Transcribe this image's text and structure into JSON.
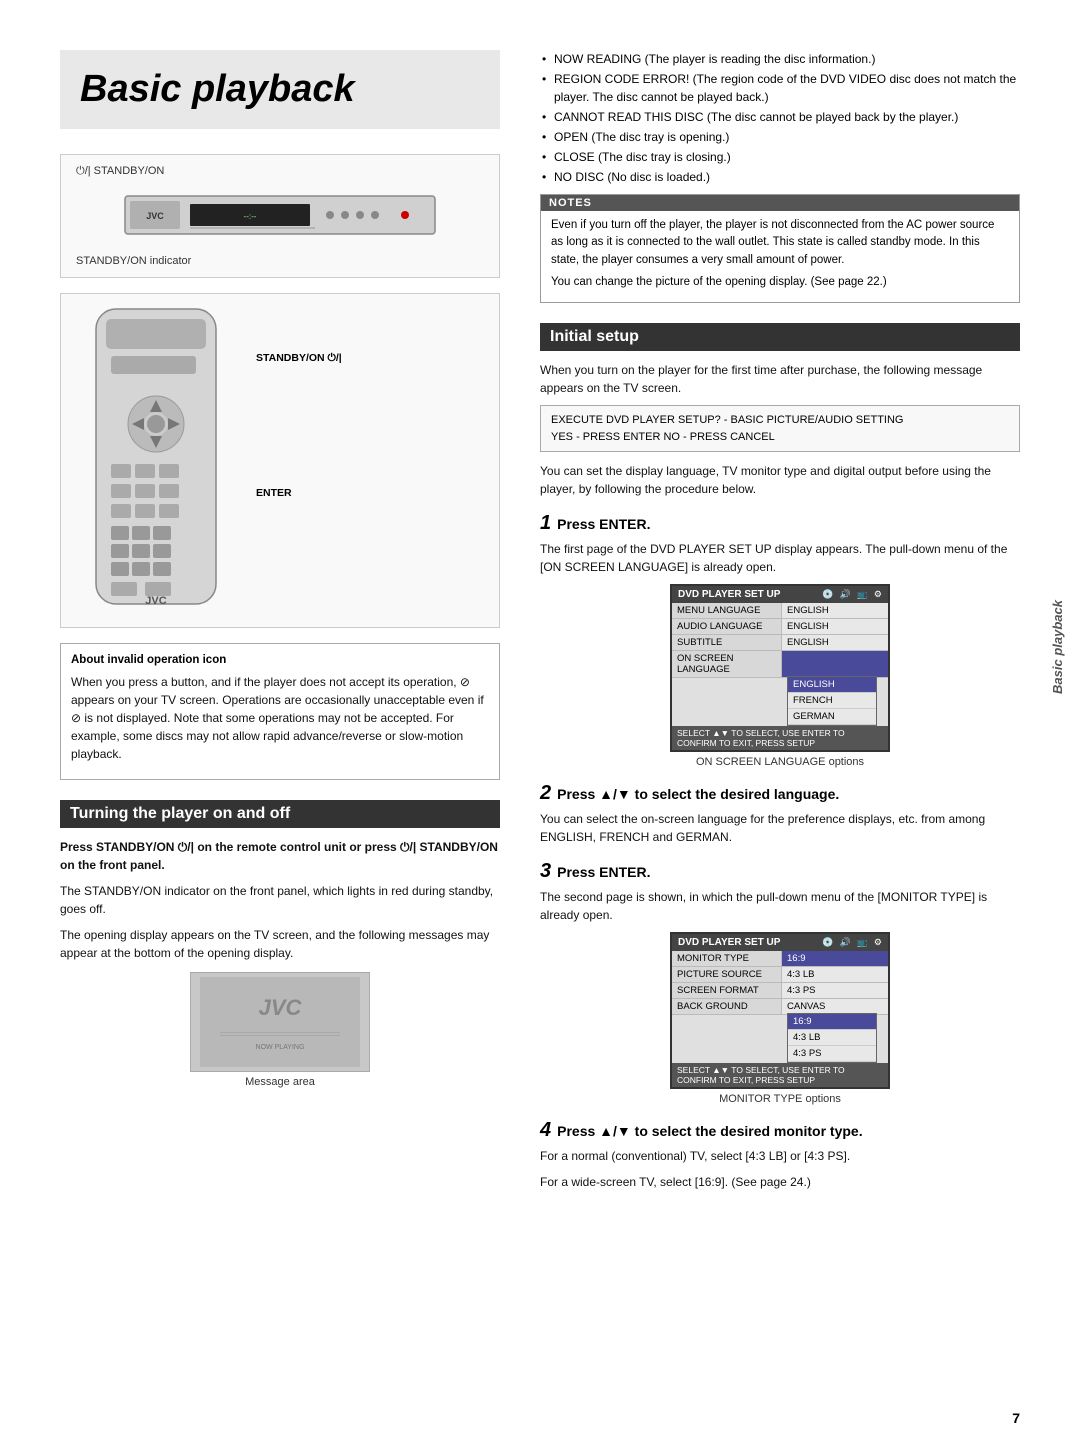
{
  "page": {
    "title": "Basic playback",
    "page_number": "7",
    "side_label": "Basic playback"
  },
  "left_column": {
    "device_section": {
      "standby_label_top": "⏻/| STANDBY/ON",
      "standby_indicator_label": "STANDBY/ON indicator"
    },
    "remote_section": {
      "standby_label": "STANDBY/ON ⏻/|",
      "enter_label": "ENTER"
    },
    "invalid_op_section": {
      "title": "About invalid operation icon",
      "body": "When you press a button, and if the player does not accept its operation, ⊘ appears on your TV screen. Operations are occasionally unacceptable even if ⊘ is not displayed. Note that some operations may not be accepted. For example, some discs may not allow rapid advance/reverse or slow-motion playback."
    },
    "turning_section": {
      "header": "Turning the player on and off",
      "body_bold": "Press STANDBY/ON ⏻/| on the remote control unit or press ⏻/| STANDBY/ON on the front panel.",
      "body1": "The STANDBY/ON indicator on the front panel, which lights in red during standby, goes off.",
      "body2": "The opening display appears on the TV screen, and the following messages may appear at the bottom of the opening display.",
      "message_area_caption": "Message area",
      "message_jvc_text": "JVC"
    }
  },
  "right_column": {
    "bullet_items": [
      "NOW READING (The player is reading the disc information.)",
      "REGION CODE ERROR! (The region code of the DVD VIDEO disc does not match the player. The disc cannot be played back.)",
      "CANNOT READ THIS DISC (The disc cannot be played back by the player.)",
      "OPEN (The disc tray is opening.)",
      "CLOSE (The disc tray is closing.)",
      "NO DISC (No disc is loaded.)"
    ],
    "notes": {
      "header": "NOTES",
      "items": [
        "Even if you turn off the player, the player is not disconnected from the AC power source as long as it is connected to the wall outlet. This state is called standby mode. In this state, the player consumes a very small amount of power.",
        "You can change the picture of the opening display. (See page 22.)"
      ]
    },
    "initial_setup": {
      "header": "Initial setup",
      "body1": "When you turn on the player for the first time after purchase, the following message appears on the TV screen.",
      "screen_box_line1": "EXECUTE DVD PLAYER SETUP? - BASIC PICTURE/AUDIO SETTING",
      "screen_box_line2": "YES - PRESS ENTER   NO - PRESS CANCEL",
      "body2": "You can set the display language, TV monitor type and digital output before using the player, by following the procedure below.",
      "steps": [
        {
          "number": "1",
          "title": "Press ENTER.",
          "body": "The first page of the DVD PLAYER SET UP display appears. The pull-down menu of the [ON SCREEN LANGUAGE] is already open.",
          "osd_caption": "ON SCREEN LANGUAGE options",
          "osd_table_title": "DVD PLAYER SET UP",
          "osd_rows": [
            {
              "left": "MENU LANGUAGE",
              "right": "ENGLISH"
            },
            {
              "left": "AUDIO LANGUAGE",
              "right": "ENGLISH"
            },
            {
              "left": "SUBTITLE",
              "right": "ENGLISH"
            },
            {
              "left": "ON SCREEN LANGUAGE",
              "right": ""
            }
          ],
          "osd_dropdown": [
            "ENGLISH",
            "FRENCH",
            "GERMAN"
          ],
          "osd_dropdown_selected": 0
        },
        {
          "number": "2",
          "title": "Press ▲/▼ to select the desired language.",
          "body": "You can select the on-screen language for the preference displays, etc. from among ENGLISH, FRENCH and GERMAN."
        },
        {
          "number": "3",
          "title": "Press ENTER.",
          "body": "The second page is shown, in which the pull-down menu of the [MONITOR TYPE] is already open.",
          "osd_caption": "MONITOR TYPE options",
          "osd_table_title": "DVD PLAYER SET UP",
          "osd_rows2": [
            {
              "left": "MONITOR TYPE",
              "right": "16:9"
            },
            {
              "left": "PICTURE SOURCE",
              "right": "4:3 LB"
            },
            {
              "left": "SCREEN FORMAT",
              "right": "4:3 PS"
            },
            {
              "left": "BACK GROUND",
              "right": "CANVAS"
            }
          ],
          "osd_dropdown2": [
            "16:9",
            "4:3 LB",
            "4:3 PS"
          ],
          "osd_dropdown2_selected": 0
        },
        {
          "number": "4",
          "title": "Press ▲/▼ to select the desired monitor type.",
          "body1": "For a normal (conventional) TV, select [4:3 LB] or [4:3 PS].",
          "body2": "For a wide-screen TV, select [16:9]. (See page 24.)"
        }
      ]
    }
  }
}
